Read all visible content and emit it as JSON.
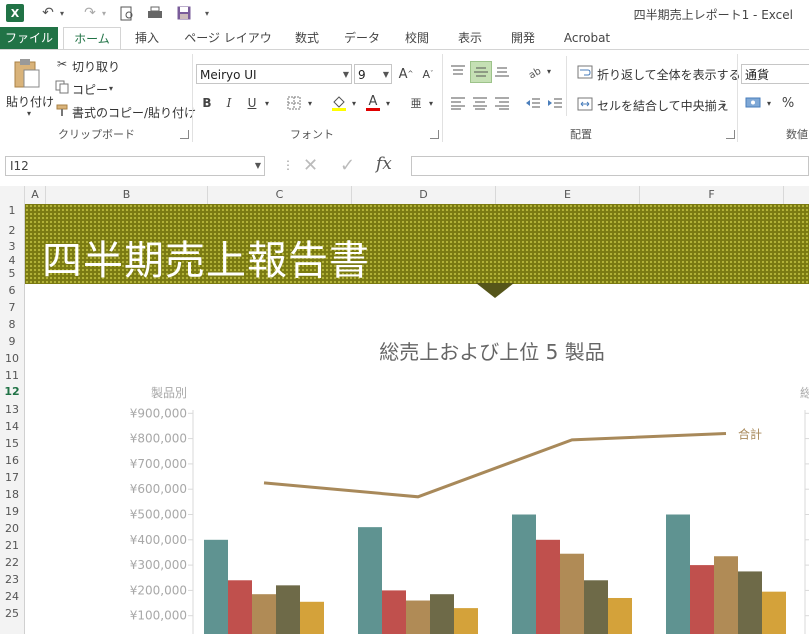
{
  "app": {
    "window_title": "四半期売上レポート1 - Excel",
    "logo": "excel-logo",
    "accent": "#217346"
  },
  "tabs": [
    {
      "label": "ファイル"
    },
    {
      "label": "ホーム"
    },
    {
      "label": "挿入"
    },
    {
      "label": "ページ レイアウト"
    },
    {
      "label": "数式"
    },
    {
      "label": "データ"
    },
    {
      "label": "校閲"
    },
    {
      "label": "表示"
    },
    {
      "label": "開発"
    },
    {
      "label": "Acrobat"
    }
  ],
  "ribbon": {
    "clipboard": {
      "paste": "貼り付け",
      "cut": "切り取り",
      "copy": "コピー",
      "format_painter": "書式のコピー/貼り付け",
      "group": "クリップボード"
    },
    "font": {
      "name": "Meiryo UI",
      "size": "9",
      "group": "フォント",
      "bold": "B",
      "italic": "I",
      "underline": "U",
      "grow": "A",
      "shrink": "A",
      "font_color_glyph": "A"
    },
    "alignment": {
      "wrap": "折り返して全体を表示する",
      "merge": "セルを結合して中央揃え",
      "group": "配置"
    },
    "number": {
      "format": "通貨",
      "percent": "%",
      "group": "数値"
    }
  },
  "formula_bar": {
    "name_box": "I12",
    "fx": "fx",
    "value": ""
  },
  "columns": [
    "A",
    "B",
    "C",
    "D",
    "E",
    "F"
  ],
  "rows": [
    "1",
    "2",
    "3",
    "4",
    "5",
    "6",
    "7",
    "8",
    "9",
    "10",
    "11",
    "12",
    "13",
    "14",
    "15",
    "16",
    "17",
    "18",
    "19",
    "20",
    "21",
    "22",
    "23",
    "24",
    "25"
  ],
  "sheet": {
    "banner_title": "四半期売上報告書",
    "banner_color": "#7a7a12"
  },
  "chart_data": {
    "type": "bar",
    "title": "総売上および上位 5 製品",
    "ylabel": "製品別",
    "secondary_ylabel": "総",
    "ylim": [
      0,
      900000
    ],
    "yticks": [
      "¥100,000",
      "¥200,000",
      "¥300,000",
      "¥400,000",
      "¥500,000",
      "¥600,000",
      "¥700,000",
      "¥800,000",
      "¥900,000"
    ],
    "series": [
      {
        "color": "#5f9391",
        "values": [
          400000,
          450000,
          500000,
          500000
        ]
      },
      {
        "color": "#c0504d",
        "values": [
          240000,
          200000,
          400000,
          300000
        ]
      },
      {
        "color": "#b08b56",
        "values": [
          185000,
          160000,
          345000,
          335000
        ]
      },
      {
        "color": "#6e6a48",
        "values": [
          220000,
          185000,
          240000,
          275000
        ]
      },
      {
        "color": "#d4a23a",
        "values": [
          155000,
          130000,
          170000,
          195000
        ]
      }
    ],
    "line": {
      "name": "合計",
      "color": "#a8895a",
      "values": [
        625000,
        570000,
        795000,
        820000
      ]
    }
  }
}
